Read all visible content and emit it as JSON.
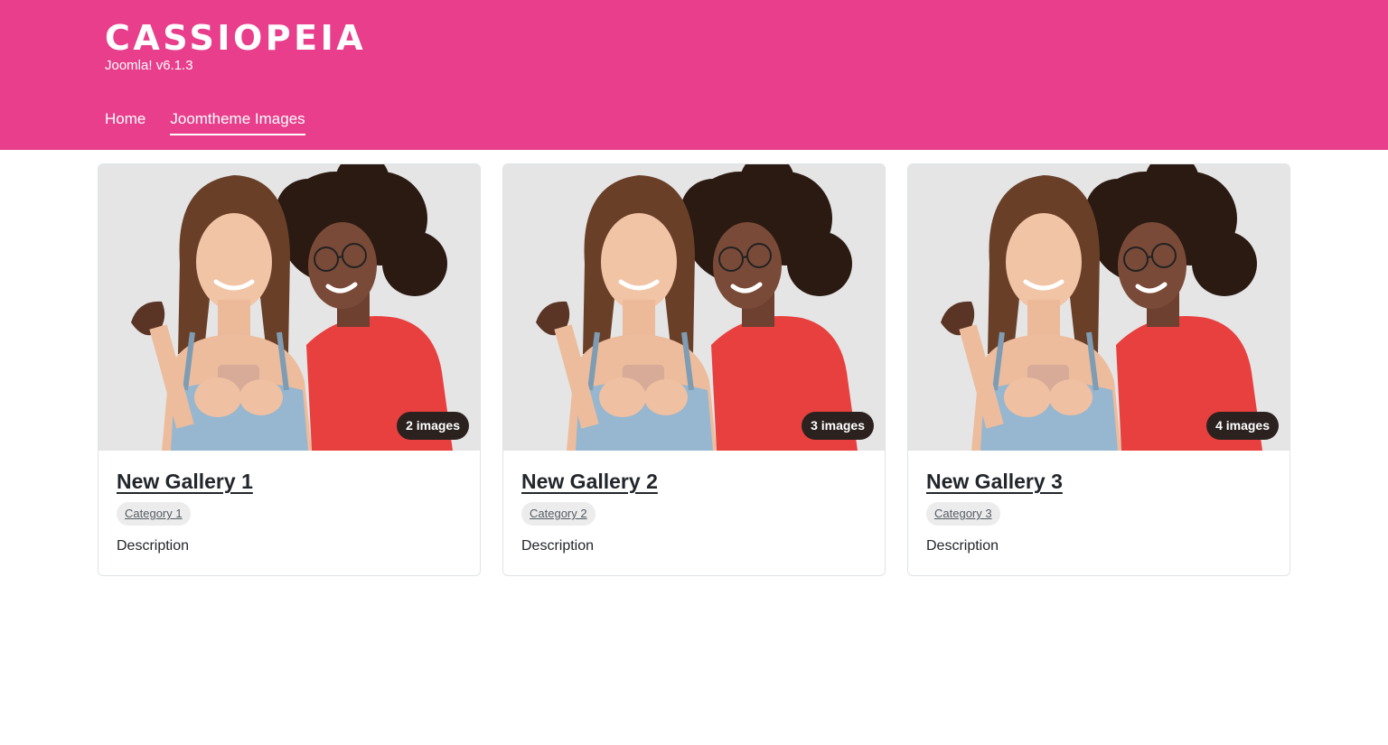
{
  "site": {
    "logo_text": "CASSIOPEIA",
    "tagline": "Joomla! v6.1.3",
    "brand_color": "#e83e8c"
  },
  "nav": {
    "items": [
      {
        "label": "Home",
        "active": false
      },
      {
        "label": "Joomtheme Images",
        "active": true
      }
    ]
  },
  "galleries": [
    {
      "title": "New Gallery 1",
      "category": "Category 1",
      "description": "Description",
      "count_label": "2 images"
    },
    {
      "title": "New Gallery 2",
      "category": "Category 2",
      "description": "Description",
      "count_label": "3 images"
    },
    {
      "title": "New Gallery 3",
      "category": "Category 3",
      "description": "Description",
      "count_label": "4 images"
    }
  ]
}
